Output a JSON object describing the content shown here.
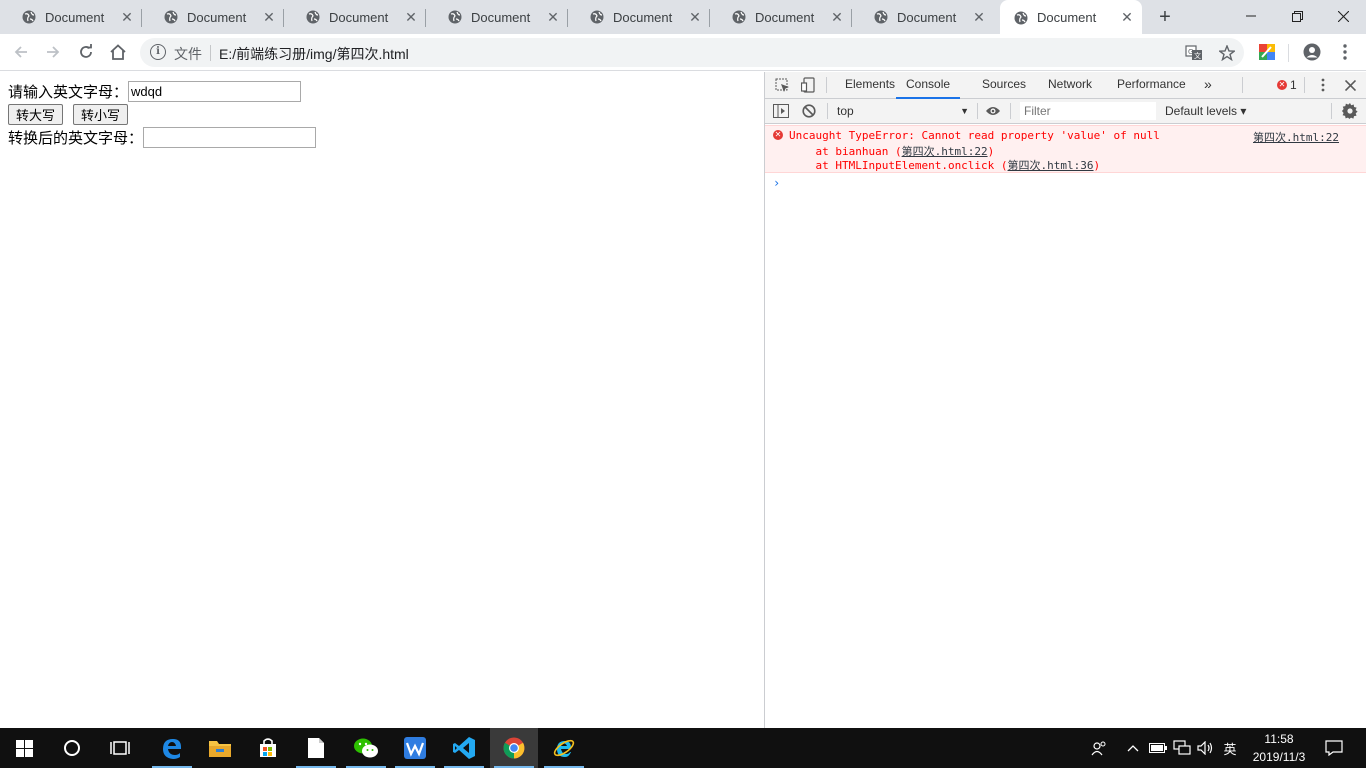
{
  "browser": {
    "tabs": [
      {
        "title": "Document",
        "active": false
      },
      {
        "title": "Document",
        "active": false
      },
      {
        "title": "Document",
        "active": false
      },
      {
        "title": "Document",
        "active": false
      },
      {
        "title": "Document",
        "active": false
      },
      {
        "title": "Document",
        "active": false
      },
      {
        "title": "Document",
        "active": false
      },
      {
        "title": "Document",
        "active": true
      }
    ],
    "address": {
      "security_chip": "文件",
      "url": "E:/前端练习册/img/第四次.html"
    }
  },
  "page": {
    "input_label": "请输入英文字母：",
    "input_value": "wdqd",
    "upper_button": "转大写",
    "lower_button": "转小写",
    "output_label": "转换后的英文字母：",
    "output_value": ""
  },
  "devtools": {
    "tabs": [
      "Elements",
      "Console",
      "Sources",
      "Network",
      "Performance"
    ],
    "active_tab": "Console",
    "more_tabs": "»",
    "error_count": "1",
    "context": "top",
    "filter_placeholder": "Filter",
    "levels": "Default levels ▾",
    "console": {
      "error_message": "Uncaught TypeError: Cannot read property 'value' of null",
      "stack1_prefix": "    at bianhuan (",
      "stack1_link": "第四次.html:22",
      "stack1_suffix": ")",
      "stack2_prefix": "    at HTMLInputElement.onclick (",
      "stack2_link": "第四次.html:36",
      "stack2_suffix": ")",
      "source": "第四次.html:22",
      "prompt": "›"
    }
  },
  "taskbar": {
    "ime": "英",
    "time": "11:58",
    "date": "2019/11/3"
  },
  "colors": {
    "tabstrip": "#dee1e6",
    "accent_blue": "#1a73e8",
    "error_red": "#ff0000",
    "error_bg": "#fff0f0",
    "taskbar": "#101010"
  }
}
